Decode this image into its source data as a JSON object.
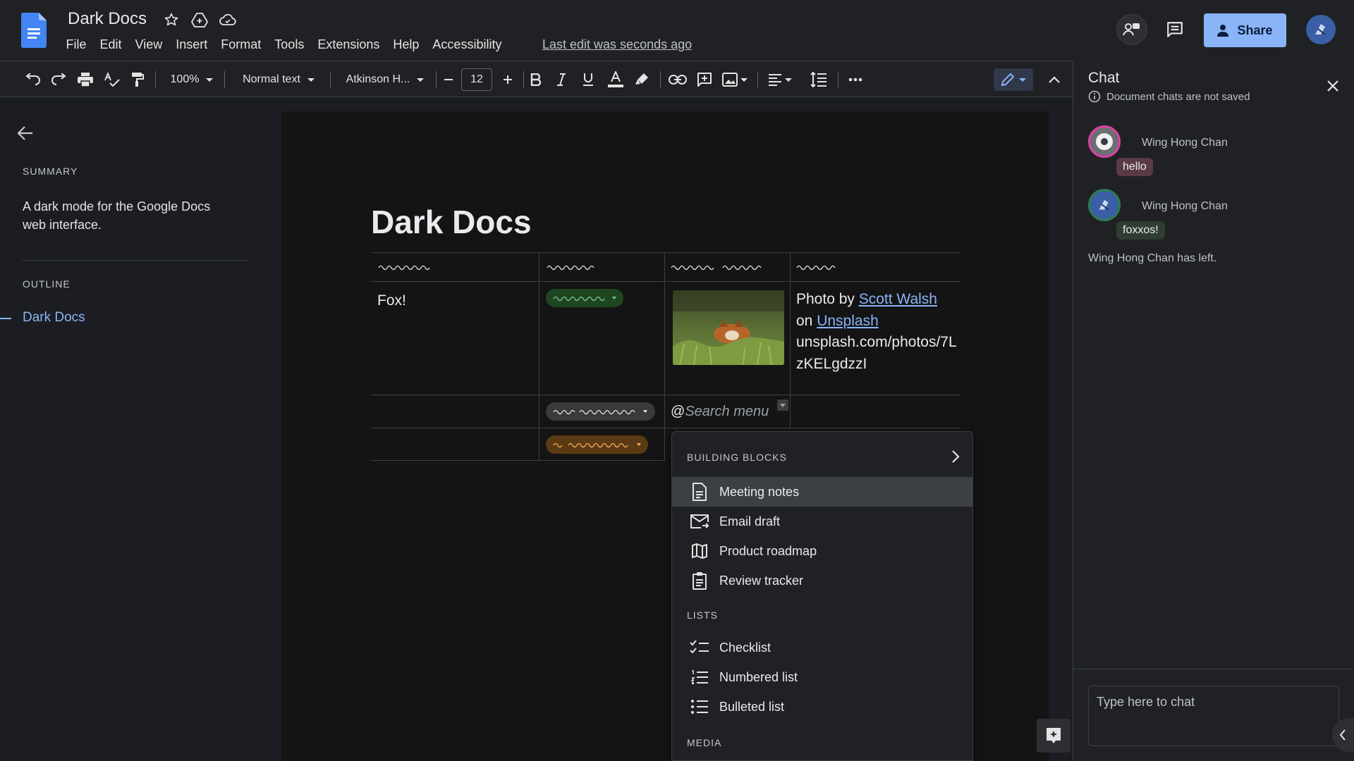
{
  "app": {
    "doc_title": "Dark Docs",
    "menu": [
      "File",
      "Edit",
      "View",
      "Insert",
      "Format",
      "Tools",
      "Extensions",
      "Help",
      "Accessibility"
    ],
    "last_edit": "Last edit was seconds ago",
    "share_label": "Share"
  },
  "toolbar": {
    "zoom": "100%",
    "style": "Normal text",
    "font": "Atkinson H...",
    "font_size": "12"
  },
  "left_panel": {
    "summary_heading": "SUMMARY",
    "summary_text": "A dark mode for the Google Docs web interface.",
    "outline_heading": "OUTLINE",
    "outline_items": [
      "Dark Docs"
    ]
  },
  "document": {
    "heading": "Dark Docs",
    "cell_fox": "Fox!",
    "credit_prefix": "Photo by ",
    "credit_author": "Scott Walsh",
    "credit_on": "on ",
    "credit_site": "Unsplash",
    "credit_url": "unsplash.com/photos/7LzKELgdzzI",
    "search_at": "@",
    "search_placeholder": "Search menu"
  },
  "dropdown": {
    "section_blocks": "BUILDING BLOCKS",
    "blocks": [
      {
        "label": "Meeting notes",
        "icon": "document-icon"
      },
      {
        "label": "Email draft",
        "icon": "email-icon"
      },
      {
        "label": "Product roadmap",
        "icon": "map-icon"
      },
      {
        "label": "Review tracker",
        "icon": "clipboard-icon"
      }
    ],
    "section_lists": "LISTS",
    "lists": [
      {
        "label": "Checklist",
        "icon": "checklist-icon"
      },
      {
        "label": "Numbered list",
        "icon": "numbered-list-icon"
      },
      {
        "label": "Bulleted list",
        "icon": "bulleted-list-icon"
      }
    ],
    "section_media": "MEDIA"
  },
  "chat": {
    "title": "Chat",
    "info": "Document chats are not saved",
    "messages": [
      {
        "name": "Wing Hong Chan",
        "text": "hello"
      },
      {
        "name": "Wing Hong Chan",
        "text": "foxxos!"
      }
    ],
    "left_notice": "Wing Hong Chan has left.",
    "input_placeholder": "Type here to chat"
  },
  "colors": {
    "accent": "#8ab4f8",
    "background": "#1b1d22",
    "page": "#141414",
    "chip_green": "#1e4620",
    "chip_orange": "#5a3a13"
  }
}
